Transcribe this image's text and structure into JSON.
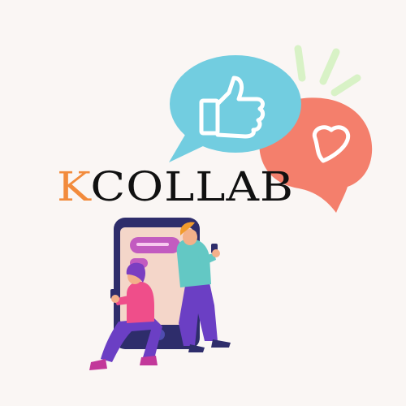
{
  "brand": {
    "first_letter": "K",
    "rest": "COLLAB",
    "first_letter_color": "#f28b3c",
    "rest_color": "#111111"
  },
  "colors": {
    "background": "#faf6f4",
    "like_bubble": "#72cde0",
    "heart_bubble": "#f47f6c",
    "sparkle": "#d8f2c6",
    "phone_frame": "#2e2d6b",
    "phone_screen": "#f4d6c9",
    "message_bubble": "#c25bc0",
    "person_pink": "#ef4e8a",
    "person_teal": "#63c8c4",
    "person_purple_pants": "#6b3fc4",
    "hair_orange": "#f19b2c",
    "hair_purple": "#7b3ec1",
    "skin": "#f3b08a"
  },
  "icons": {
    "like": "thumbs-up-icon",
    "heart": "heart-icon"
  }
}
